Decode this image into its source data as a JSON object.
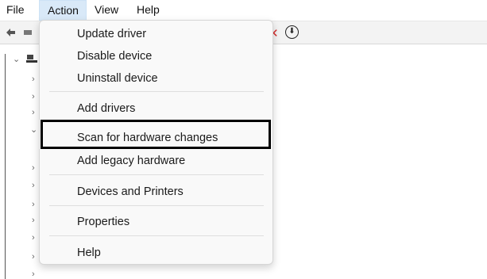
{
  "menubar": {
    "items": [
      {
        "label": "File"
      },
      {
        "label": "Action"
      },
      {
        "label": "View"
      },
      {
        "label": "Help"
      }
    ]
  },
  "toolbar": {
    "icons": [
      "back-arrow-icon",
      "remove-icon",
      "download-icon"
    ]
  },
  "action_menu": {
    "items": [
      {
        "label": "Update driver"
      },
      {
        "label": "Disable device"
      },
      {
        "label": "Uninstall device"
      },
      {
        "label": "Add drivers"
      },
      {
        "label": "Scan for hardware changes",
        "highlighted": true
      },
      {
        "label": "Add legacy hardware"
      },
      {
        "label": "Devices and Printers"
      },
      {
        "label": "Properties"
      },
      {
        "label": "Help"
      }
    ]
  },
  "colors": {
    "menubar_active": "#d9e9f8",
    "menu_bg": "#f9f9f9",
    "highlight_border": "#000000",
    "remove_icon": "#d42a2a"
  }
}
